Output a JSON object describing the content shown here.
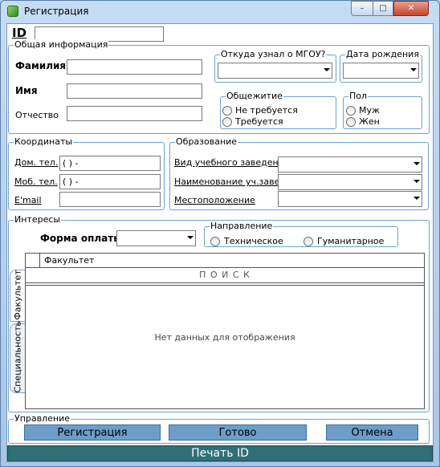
{
  "window": {
    "title": "Регистрация",
    "minimize_glyph": "–",
    "maximize_glyph": "□",
    "close_glyph": "✕"
  },
  "id_field": {
    "label": "ID",
    "value": ""
  },
  "general": {
    "title": "Общая информация",
    "surname_label": "Фамилия",
    "name_label": "Имя",
    "patronymic_label": "Отчество",
    "source": {
      "title": "Откуда узнал о МГОУ?",
      "value": ""
    },
    "birthdate": {
      "title": "Дата рождения",
      "value": ""
    },
    "dormitory": {
      "title": "Общежитие",
      "options": [
        "Не требуется",
        "Требуется"
      ]
    },
    "gender": {
      "title": "Пол",
      "options": [
        "Муж",
        "Жен"
      ]
    }
  },
  "contacts": {
    "title": "Координаты",
    "home_phone_label": "Дом. тел.",
    "home_phone_value": "(  )  -",
    "mobile_label": "Моб. тел.",
    "mobile_value": "(  )  -",
    "email_label": "E'mail",
    "email_value": ""
  },
  "education": {
    "title": "Образование",
    "type_label": "Вид учебного заведения",
    "name_label": "Наименование уч.завед.",
    "location_label": "Местоположение"
  },
  "interests": {
    "title": "Интересы",
    "payment_label": "Форма оплаты",
    "payment_value": "",
    "direction": {
      "title": "Направление",
      "options": [
        "Техническое",
        "Гуманитарное"
      ]
    },
    "side_tabs": [
      "Факультет",
      "Специальность"
    ],
    "grid": {
      "columns": [
        "Факультет"
      ],
      "search_label": "П О И С К",
      "empty_text": "Нет данных для отображения"
    }
  },
  "management": {
    "title": "Управление",
    "register_label": "Регистрация",
    "done_label": "Готово",
    "cancel_label": "Отмена"
  },
  "print_id_label": "Печать ID",
  "colors": {
    "accent": "#6d9ec9",
    "print_bar": "#2f6f78",
    "group_border": "#6aa3d0"
  }
}
